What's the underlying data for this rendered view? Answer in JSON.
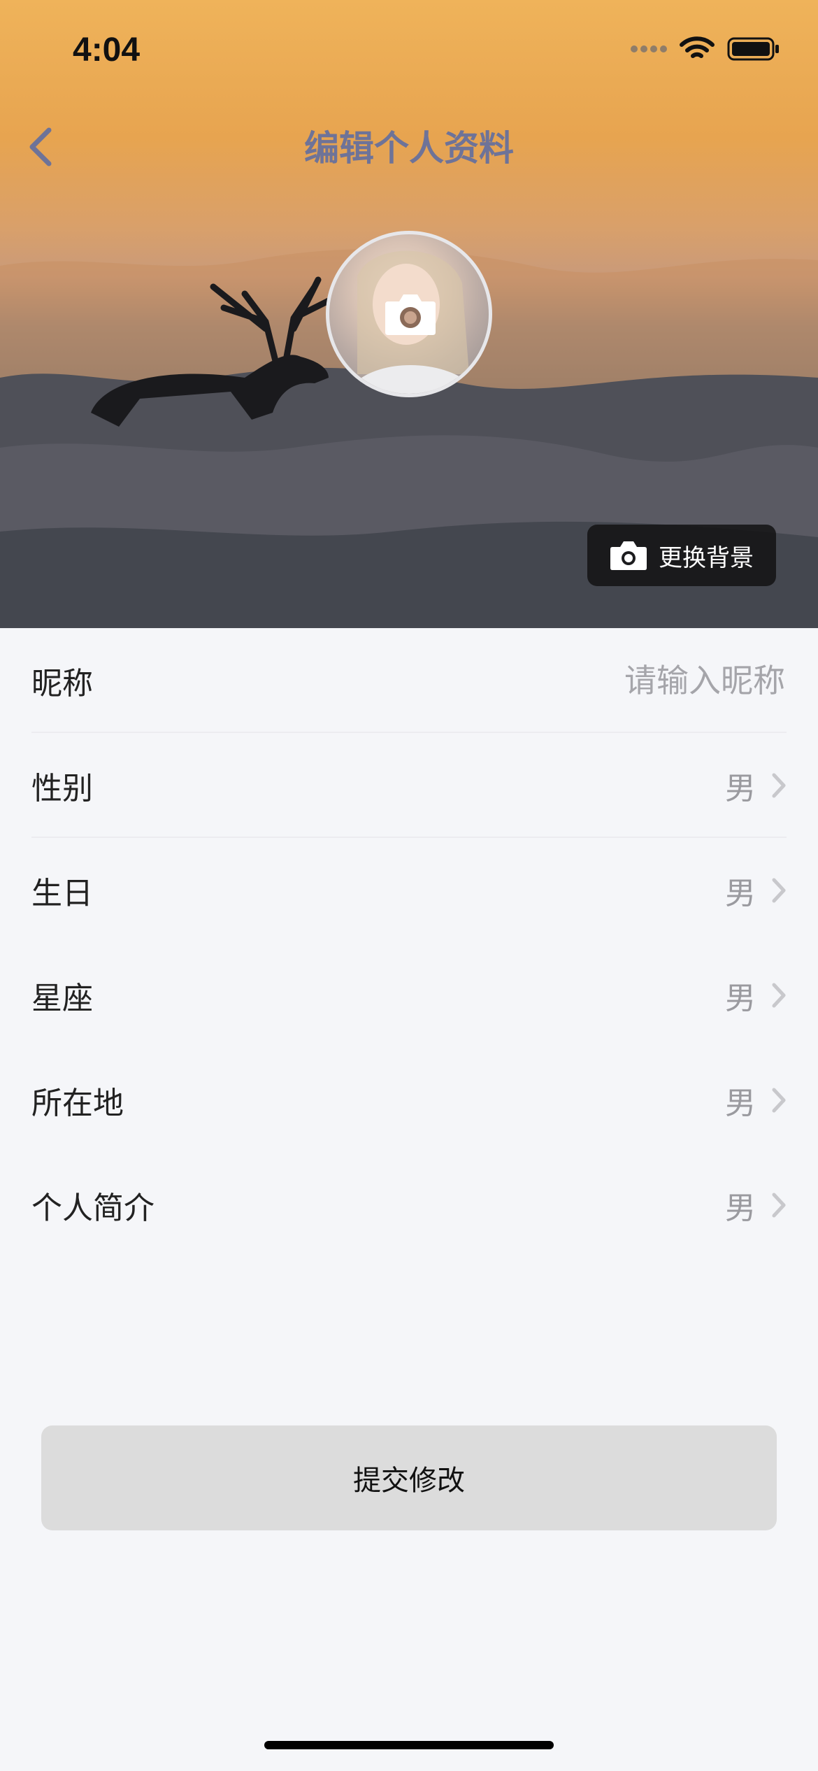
{
  "status_bar": {
    "time": "4:04"
  },
  "header": {
    "title": "编辑个人资料"
  },
  "hero": {
    "change_background_label": "更换背景"
  },
  "form": {
    "nickname": {
      "label": "昵称",
      "placeholder": "请输入昵称",
      "value": ""
    },
    "rows": [
      {
        "label": "性别",
        "value": "男"
      },
      {
        "label": "生日",
        "value": "男"
      },
      {
        "label": "星座",
        "value": "男"
      },
      {
        "label": "所在地",
        "value": "男"
      },
      {
        "label": "个人简介",
        "value": "男"
      }
    ]
  },
  "submit": {
    "label": "提交修改"
  },
  "colors": {
    "title": "#6e7398",
    "submit_bg": "#dcdcdc",
    "page_bg": "#f5f6f9"
  }
}
